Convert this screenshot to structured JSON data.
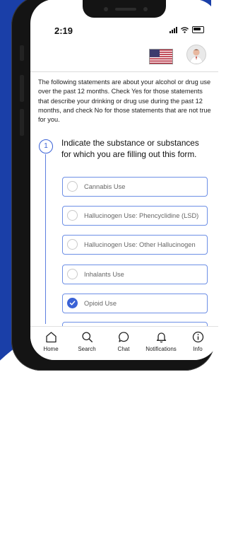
{
  "status_bar": {
    "time": "2:19"
  },
  "header": {
    "flag_icon": "us-flag-icon",
    "avatar_icon": "user-avatar-icon"
  },
  "intro_text": "The following statements are about your alcohol or drug use over the past 12 months. Check Yes for those statements that describe your drinking or drug use during the past 12 months, and check No for those statements that are not true for you.",
  "question": {
    "number": "1",
    "text": "Indicate the substance or substances for which you are filling out this form.",
    "options": [
      {
        "label": "Cannabis Use",
        "selected": false
      },
      {
        "label": "Hallucinogen Use: Phencyclidine (LSD)",
        "selected": false
      },
      {
        "label": "Hallucinogen Use: Other Hallucinogen",
        "selected": false
      },
      {
        "label": "Inhalants Use",
        "selected": false
      },
      {
        "label": "Opioid Use",
        "selected": true
      }
    ]
  },
  "tabbar": {
    "items": [
      {
        "label": "Home",
        "icon": "home-icon"
      },
      {
        "label": "Search",
        "icon": "search-icon"
      },
      {
        "label": "Chat",
        "icon": "chat-icon"
      },
      {
        "label": "Notifications",
        "icon": "bell-icon"
      },
      {
        "label": "Info",
        "icon": "info-icon"
      }
    ]
  },
  "colors": {
    "accent": "#3a62d6",
    "background_blue": "#1a3fa8",
    "option_border": "#6d8fe6"
  }
}
